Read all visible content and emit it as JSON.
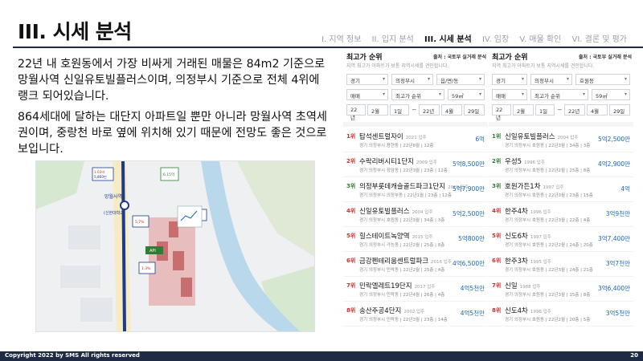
{
  "slide": {
    "title": "III. 시세 분석",
    "nav": [
      {
        "label": "I. 지역 정보",
        "active": false
      },
      {
        "label": "II. 입지 분석",
        "active": false
      },
      {
        "label": "III. 시세 분석",
        "active": true
      },
      {
        "label": "IV. 임장",
        "active": false
      },
      {
        "label": "V. 매물 확인",
        "active": false
      },
      {
        "label": "VI. 결론 및 평가",
        "active": false
      }
    ],
    "para1": "22년 내 호원동에서 가장 비싸게 거래된 매물은 84m2 기준으로 망월사역 신일유토빌플러스이며, 의정부시 기준으로 전체 4위에 랭크 되어있습니다.",
    "para2": "864세대에 달하는 대단지 아파트일 뿐만 아니라 망월사역 초역세권이며, 중랑천 바로 옆에 위치해 있기 때문에 전망도 좋은 것으로 보입니다.",
    "footer_text": "Copyright 2022 by SMS All rights reserved",
    "page_number": "20"
  },
  "map": {
    "station_label": "망월사역",
    "line_label": "(신한대학교)",
    "marker_labels": [
      "1.03억 5,860만",
      "5.7%",
      "6.15억",
      "6.2%",
      "1.3%",
      "API"
    ]
  },
  "panels": [
    {
      "title": "최고가 순위",
      "source": "출처 : 국토부 실거래 분석",
      "note": "지역 최고가 아파트가 보통 지역시세를 견인합니다.",
      "filters": [
        "경기",
        "의정부시",
        "읍/면/동",
        "매매",
        "최고가 순위",
        "59㎡",
        "22년",
        "2월",
        "1일",
        "22년",
        "4월",
        "29일"
      ],
      "rows": [
        {
          "rank": "1위",
          "name": "탑석센트럴자이",
          "year": "2021 입주",
          "sub": "경기 의정부시 용현동 | 22년8월 | 12층",
          "price": "6억"
        },
        {
          "rank": "2위",
          "name": "수락리버시티1단지",
          "year": "2009 입주",
          "sub": "경기 의정부시 장암동 | 22년3월 | 23층 | 12층",
          "price": "5억8,500만"
        },
        {
          "rank": "3위",
          "name": "의정부롯데캐슬골드파크1단지",
          "year": "2019 입주",
          "sub": "경기 의정부시 의정부동 | 22년1월 | 23층 | 12층",
          "price": "5억7,900만"
        },
        {
          "rank": "4위",
          "name": "신일유토빌플러스",
          "year": "2004 입주",
          "sub": "경기 의정부시 호원동 | 22년3월 | 34층 | 3층",
          "price": "5억2,500만"
        },
        {
          "rank": "5위",
          "name": "힐스테이트녹양역",
          "year": "2015 입주",
          "sub": "경기 의정부시 가능동 | 22년2월 | 25층 | 8층",
          "price": "5억800만"
        },
        {
          "rank": "6위",
          "name": "금강펜테리움센트럴파크",
          "year": "2016 입주",
          "sub": "경기 의정부시 민락동 | 22년2월 | 25층 | 4층",
          "price": "4억6,500만"
        },
        {
          "rank": "7위",
          "name": "민락엘레트19단지",
          "year": "2017 입주",
          "sub": "경기 의정부시 민락동 | 22년4월 | 26층 | 4층",
          "price": "4억5천만"
        },
        {
          "rank": "8위",
          "name": "송산주공4단지",
          "year": "2002 입주",
          "sub": "경기 의정부시 민락동 | 22년3월 | 23층 | 14층",
          "price": "4억5천만"
        }
      ]
    },
    {
      "title": "최고가 순위",
      "source": "출처 : 국토부 실거래 분석",
      "note": "지역 최고가 아파트가 보통 지역시세를 견인합니다.",
      "filters": [
        "경기",
        "의정부시",
        "호원동",
        "매매",
        "최고가 순위",
        "59㎡",
        "22년",
        "2월",
        "1일",
        "22년",
        "4월",
        "29일"
      ],
      "rows": [
        {
          "rank": "1위",
          "name": "신일유토빌플러스",
          "year": "2004 입주",
          "sub": "경기 의정부시 호원동 | 22년3월 | 34층 | 3층",
          "price": "5억2,500만"
        },
        {
          "rank": "2위",
          "name": "우성5",
          "year": "1996 입주",
          "sub": "경기 의정부시 호원동 | 22년2월 | 25층 | 8층",
          "price": "4억2,900만"
        },
        {
          "rank": "3위",
          "name": "호원가든1차",
          "year": "1997 입주",
          "sub": "경기 의정부시 호원동 | 22년3월 | 23층 | 15층",
          "price": "4억"
        },
        {
          "rank": "4위",
          "name": "한주4차",
          "year": "1996 입주",
          "sub": "경기 의정부시 호원동 | 22년3월 | 22층 | 4층",
          "price": "3억9천만"
        },
        {
          "rank": "5위",
          "name": "신도6차",
          "year": "1997 입주",
          "sub": "경기 의정부시 호원동 | 22년2월 | 24층 | 20층",
          "price": "3억7,400만"
        },
        {
          "rank": "6위",
          "name": "한주3차",
          "year": "1995 입주",
          "sub": "경기 의정부시 호원동 | 22년3월 | 24층 | 21층",
          "price": "3억7천만"
        },
        {
          "rank": "7위",
          "name": "신일",
          "year": "1988 입주",
          "sub": "경기 의정부시 호원동 | 22년3월 | 15층 | 8층",
          "price": "3억6,400만"
        },
        {
          "rank": "8위",
          "name": "신도4차",
          "year": "1996 입주",
          "sub": "경기 의정부시 호원동 | 22년2월 | 20층 | 5층",
          "price": "3억5천만"
        }
      ]
    }
  ]
}
